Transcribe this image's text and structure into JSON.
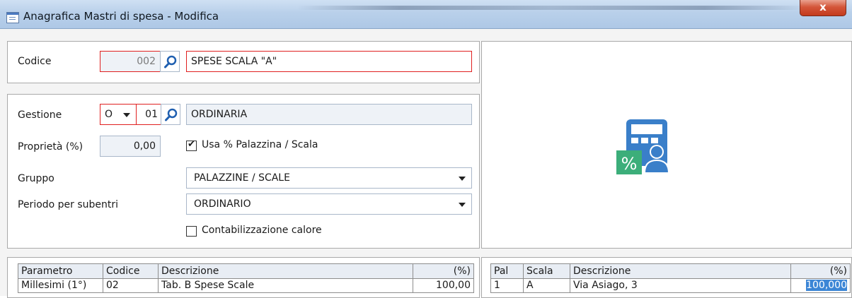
{
  "window": {
    "title": "Anagrafica Mastri di spesa - Modifica",
    "close_label": "x"
  },
  "codice": {
    "label": "Codice",
    "value": "002",
    "descrizione": "SPESE SCALA \"A\""
  },
  "gestione": {
    "label": "Gestione",
    "tipo": "O",
    "numero": "01",
    "descrizione": "ORDINARIA"
  },
  "proprieta": {
    "label": "Proprietà (%)",
    "value": "0,00"
  },
  "usa_palazzina": {
    "label": "Usa % Palazzina / Scala",
    "checked": true
  },
  "gruppo": {
    "label": "Gruppo",
    "value": "PALAZZINE / SCALE"
  },
  "periodo": {
    "label": "Periodo per subentri",
    "value": "ORDINARIO"
  },
  "contabilizzazione": {
    "label": "Contabilizzazione calore",
    "checked": false
  },
  "left_grid": {
    "headers": [
      "Parametro",
      "Codice",
      "Descrizione",
      "(%)"
    ],
    "rows": [
      [
        "Millesimi (1°)",
        "02",
        "Tab. B Spese Scale",
        "100,00"
      ]
    ]
  },
  "right_grid": {
    "headers": [
      "Pal",
      "Scala",
      "Descrizione",
      "(%)"
    ],
    "rows": [
      [
        "1",
        "A",
        "Via Asiago, 3",
        "100,000"
      ]
    ]
  },
  "icons": {
    "app": "window-form-icon",
    "search": "magnifier-icon",
    "illustration": "calculator-percent-user-icon"
  },
  "colors": {
    "required_border": "#e02020",
    "selection": "#3c86d6",
    "icon_blue": "#3a7fc9",
    "icon_green": "#3cae7a"
  }
}
